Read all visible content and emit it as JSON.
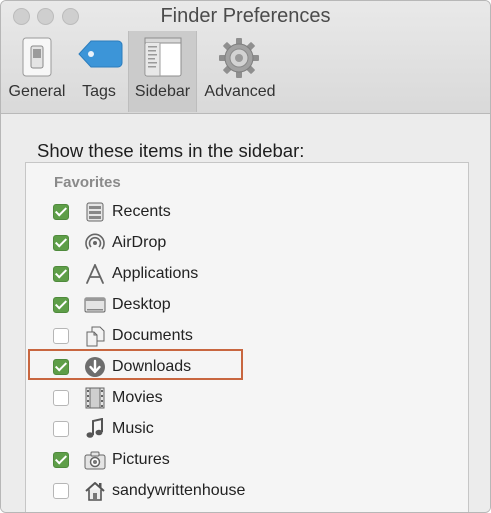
{
  "window": {
    "title": "Finder Preferences"
  },
  "toolbar": {
    "tabs": [
      {
        "label": "General",
        "icon": "general-switch-icon"
      },
      {
        "label": "Tags",
        "icon": "tag-icon"
      },
      {
        "label": "Sidebar",
        "icon": "sidebar-icon",
        "selected": true
      },
      {
        "label": "Advanced",
        "icon": "gear-icon"
      }
    ]
  },
  "content": {
    "heading": "Show these items in the sidebar:",
    "section": "Favorites",
    "items": [
      {
        "label": "Recents",
        "checked": true,
        "icon": "recents-icon"
      },
      {
        "label": "AirDrop",
        "checked": true,
        "icon": "airdrop-icon"
      },
      {
        "label": "Applications",
        "checked": true,
        "icon": "applications-icon"
      },
      {
        "label": "Desktop",
        "checked": true,
        "icon": "desktop-icon"
      },
      {
        "label": "Documents",
        "checked": false,
        "icon": "documents-icon"
      },
      {
        "label": "Downloads",
        "checked": true,
        "icon": "downloads-icon",
        "highlighted": true
      },
      {
        "label": "Movies",
        "checked": false,
        "icon": "movies-icon"
      },
      {
        "label": "Music",
        "checked": false,
        "icon": "music-icon"
      },
      {
        "label": "Pictures",
        "checked": true,
        "icon": "pictures-icon"
      },
      {
        "label": "sandywrittenhouse",
        "checked": false,
        "icon": "home-icon"
      }
    ]
  },
  "colors": {
    "checkbox_on": "#5e9e48",
    "highlight": "#c8663f",
    "tag_blue": "#3c95d8"
  }
}
